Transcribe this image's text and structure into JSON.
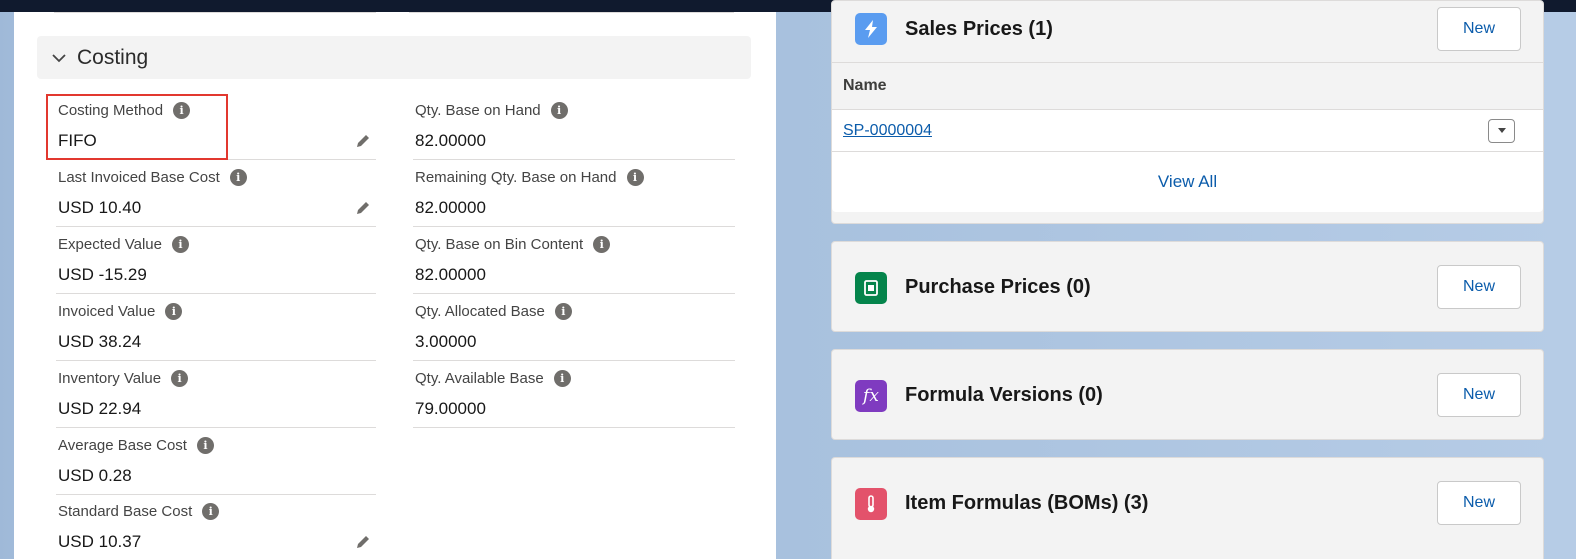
{
  "costing_section": {
    "title": "Costing",
    "left_fields": [
      {
        "label": "Costing Method",
        "value": "FIFO"
      },
      {
        "label": "Last Invoiced Base Cost",
        "value": "USD 10.40"
      },
      {
        "label": "Expected Value",
        "value": "USD -15.29"
      },
      {
        "label": "Invoiced Value",
        "value": "USD 38.24"
      },
      {
        "label": "Inventory Value",
        "value": "USD 22.94"
      },
      {
        "label": "Average Base Cost",
        "value": "USD 0.28"
      },
      {
        "label": "Standard Base Cost",
        "value": "USD 10.37"
      }
    ],
    "right_fields": [
      {
        "label": "Qty. Base on Hand",
        "value": "82.00000"
      },
      {
        "label": "Remaining Qty. Base on Hand",
        "value": "82.00000"
      },
      {
        "label": "Qty. Base on Bin Content",
        "value": "82.00000"
      },
      {
        "label": "Qty. Allocated Base",
        "value": "3.00000"
      },
      {
        "label": "Qty. Available Base",
        "value": "79.00000"
      }
    ],
    "info_glyph": "i"
  },
  "related_lists": {
    "sales_prices": {
      "title": "Sales Prices (1)",
      "new_label": "New",
      "column_name": "Name",
      "rows": [
        {
          "name": "SP-0000004"
        }
      ],
      "view_all_label": "View All",
      "icon": "lightning-icon",
      "icon_color": "#5a9cf0"
    },
    "purchase_prices": {
      "title": "Purchase Prices (0)",
      "new_label": "New",
      "icon": "price-book-icon",
      "icon_color": "#04844b"
    },
    "formula_versions": {
      "title": "Formula Versions (0)",
      "new_label": "New",
      "icon": "formula-icon",
      "icon_color": "#7f3bc0",
      "icon_text": "fx"
    },
    "item_formulas": {
      "title": "Item Formulas (BOMs) (3)",
      "new_label": "New",
      "icon": "thermometer-icon",
      "icon_color": "#e3526b"
    }
  },
  "colors": {
    "link": "#0b5cab",
    "highlight": "#e2382f",
    "top_bar": "#101a2e"
  }
}
